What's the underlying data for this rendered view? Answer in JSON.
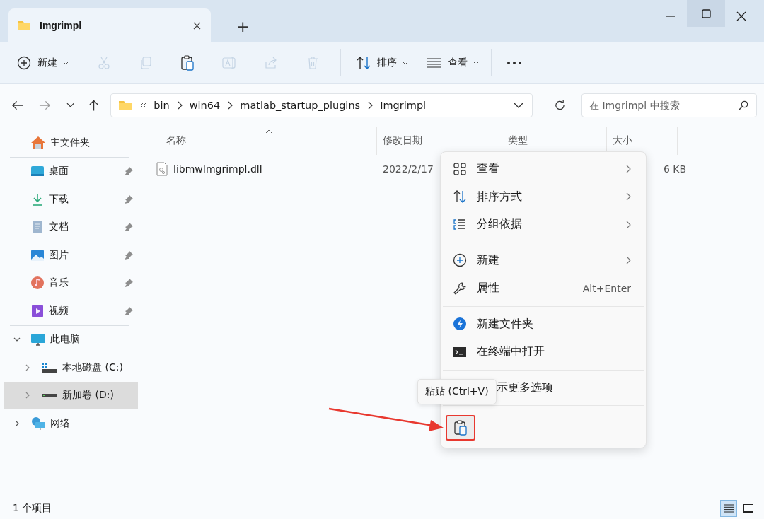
{
  "tab": {
    "title": "Imgrimpl",
    "add": "+"
  },
  "toolbar": [
    {
      "kind": "new",
      "label": "新建",
      "disabled": false
    },
    {
      "kind": "cut",
      "disabled": true
    },
    {
      "kind": "copy",
      "disabled": true
    },
    {
      "kind": "paste",
      "disabled": false
    },
    {
      "kind": "rename",
      "disabled": true
    },
    {
      "kind": "share",
      "disabled": true
    },
    {
      "kind": "delete",
      "disabled": true
    },
    {
      "kind": "sort",
      "label": "排序",
      "disabled": false
    },
    {
      "kind": "view",
      "label": "查看",
      "disabled": false
    },
    {
      "kind": "more",
      "disabled": false
    }
  ],
  "address": {
    "path": [
      "bin",
      "win64",
      "matlab_startup_plugins",
      "Imgrimpl"
    ]
  },
  "search": {
    "placeholder": "在 Imgrimpl 中搜索"
  },
  "sidebar": {
    "home": "主文件夹",
    "quick_access": [
      {
        "kind": "desktop",
        "label": "桌面",
        "pinned": true
      },
      {
        "kind": "downloads",
        "label": "下载",
        "pinned": true
      },
      {
        "kind": "documents",
        "label": "文档",
        "pinned": true
      },
      {
        "kind": "pictures",
        "label": "图片",
        "pinned": true
      },
      {
        "kind": "music",
        "label": "音乐",
        "pinned": true
      },
      {
        "kind": "videos",
        "label": "视频",
        "pinned": true
      }
    ],
    "tree": [
      {
        "kind": "pc",
        "label": "此电脑",
        "expanded": true,
        "selected": false,
        "children": [
          {
            "kind": "drive_c",
            "label": "本地磁盘 (C:)",
            "expanded": false,
            "selected": false
          },
          {
            "kind": "drive",
            "label": "新加卷 (D:)",
            "expanded": false,
            "selected": true
          }
        ]
      },
      {
        "kind": "network",
        "label": "网络",
        "expanded": false,
        "selected": false
      }
    ]
  },
  "columns": [
    "名称",
    "修改日期",
    "类型",
    "大小"
  ],
  "rows": [
    {
      "name": "libmwImgrimpl.dll",
      "date": "2022/2/17",
      "size": "6 KB"
    }
  ],
  "context_menu": {
    "items": [
      {
        "kind": "view",
        "label": "查看",
        "submenu": true
      },
      {
        "kind": "sort",
        "label": "排序方式",
        "submenu": true
      },
      {
        "kind": "group",
        "label": "分组依据",
        "submenu": true
      },
      {
        "kind": "separator"
      },
      {
        "kind": "new",
        "label": "新建",
        "submenu": true
      },
      {
        "kind": "properties",
        "label": "属性",
        "shortcut": "Alt+Enter"
      },
      {
        "kind": "separator"
      },
      {
        "kind": "new_folder",
        "label": "新建文件夹"
      },
      {
        "kind": "terminal",
        "label": "在终端中打开"
      },
      {
        "kind": "separator"
      },
      {
        "kind": "covered",
        "label": "示更多选项"
      },
      {
        "kind": "separator"
      }
    ],
    "actions": [
      {
        "kind": "paste",
        "highlighted": true
      }
    ],
    "tooltip": "粘贴 (Ctrl+V)"
  },
  "status_bar": {
    "count": "1 个项目",
    "views": [
      {
        "kind": "details",
        "selected": true
      },
      {
        "kind": "tiles",
        "selected": false
      }
    ]
  }
}
